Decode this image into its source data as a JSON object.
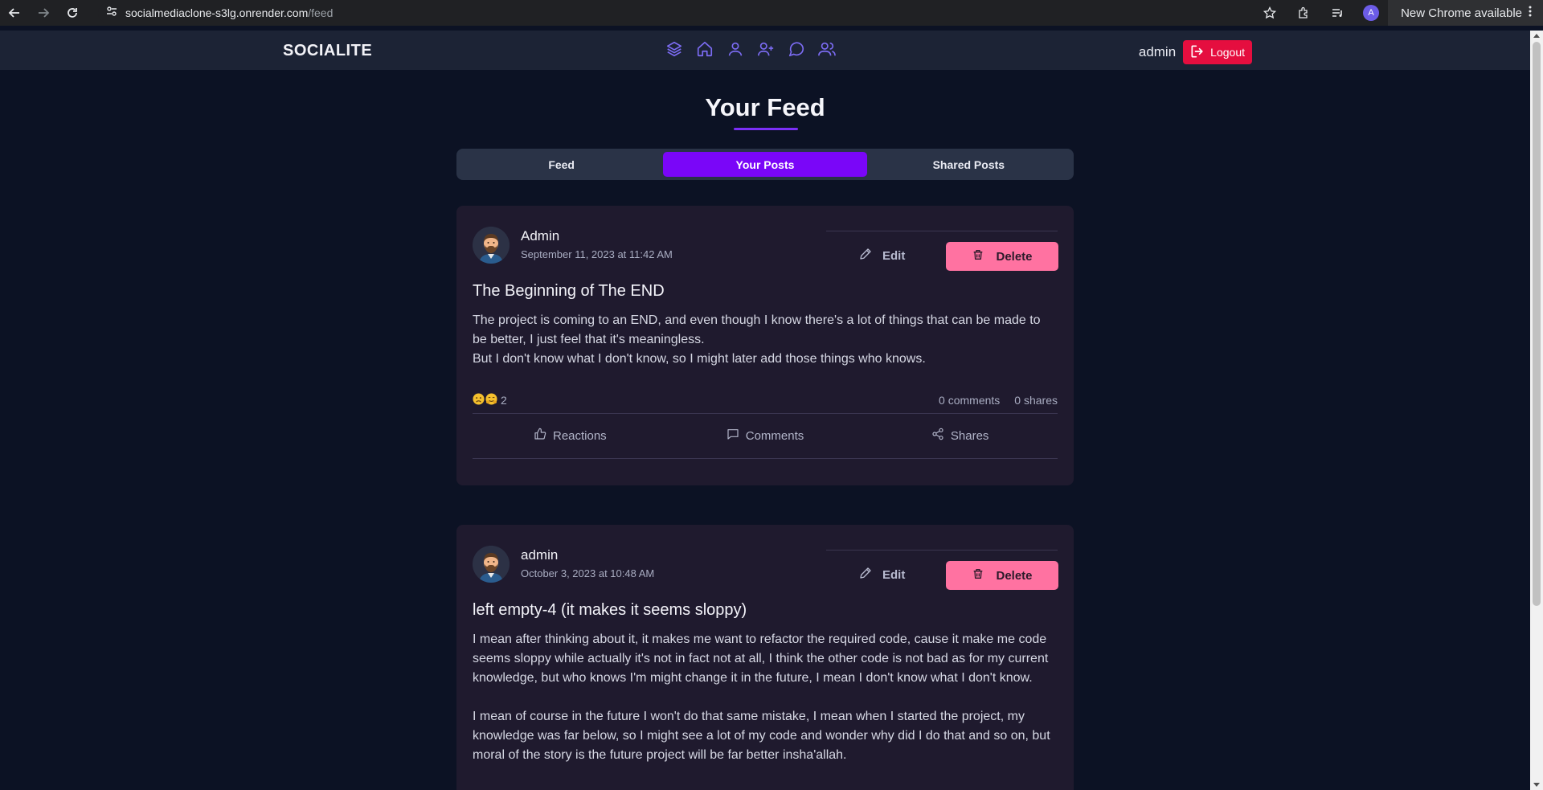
{
  "browser": {
    "url_host": "socialmediaclone-s3lg.onrender.com",
    "url_path": "/feed",
    "profile_initial": "A",
    "update_label": "New Chrome available"
  },
  "app": {
    "brand": "SOCIALITE",
    "username": "admin",
    "logout_label": "Logout",
    "accent": "#7a06f8",
    "danger": "#e50e3f",
    "nav_icons": [
      "layers-icon",
      "home-icon",
      "user-icon",
      "user-plus-icon",
      "chat-icon",
      "users-icon"
    ]
  },
  "page": {
    "title": "Your Feed",
    "tabs": [
      {
        "label": "Feed",
        "active": false
      },
      {
        "label": "Your Posts",
        "active": true
      },
      {
        "label": "Shared Posts",
        "active": false
      }
    ]
  },
  "posts": [
    {
      "author": "Admin",
      "date": "September 11, 2023 at 11:42 AM",
      "edit_label": "Edit",
      "delete_label": "Delete",
      "title": "The Beginning of The END",
      "body": [
        "The project is coming to an END, and even though I know there's a lot of things that can be made to be better, I just feel that it's meaningless.",
        "But I don't know what I don't know, so I might later add those things who knows."
      ],
      "reaction_count": "2",
      "comments": "0 comments",
      "shares": "0 shares",
      "actions": {
        "reactions": "Reactions",
        "comments": "Comments",
        "shares": "Shares"
      }
    },
    {
      "author": "admin",
      "date": "October 3, 2023 at 10:48 AM",
      "edit_label": "Edit",
      "delete_label": "Delete",
      "title": "left empty-4 (it makes it seems sloppy)",
      "body": [
        "I mean after thinking about it, it makes me want to refactor the required code, cause it make me code seems sloppy while actually it's not in fact not at all, I think the other code is not bad as for my current knowledge, but who knows I'm might change it in the future, I mean I don't know what I don't know.",
        "I mean of course in the future I won't do that same mistake, I mean when I started the project, my knowledge was far below, so I might see a lot of my code and wonder why did I do that and so on, but moral of the story is the future project will be far better insha'allah."
      ]
    }
  ]
}
